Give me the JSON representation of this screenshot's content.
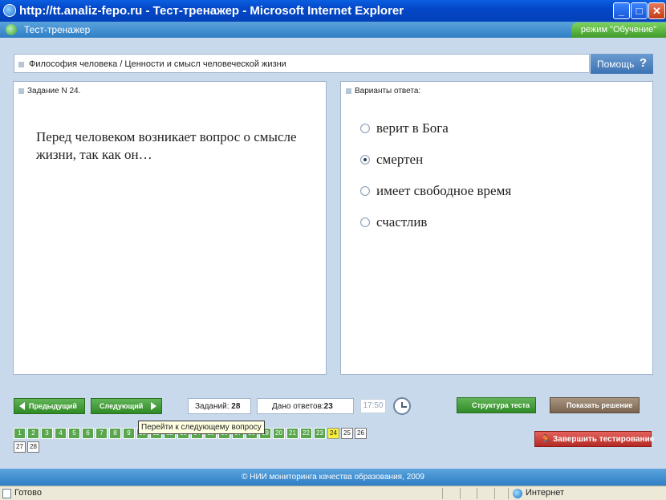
{
  "window": {
    "title": "http://tt.analiz-fepo.ru - Тест-тренажер - Microsoft Internet Explorer",
    "minimize": "_",
    "maximize": "□",
    "close": "✕"
  },
  "app": {
    "title": "Тест-тренажер",
    "mode": "режим \"Обучение\""
  },
  "breadcrumb": "Философия человека / Ценности и смысл человеческой жизни",
  "help": {
    "label": "Помощь",
    "icon": "?"
  },
  "task": {
    "header": "Задание N 24.",
    "question": "Перед человеком возникает вопрос о смысле жизни, так как он…"
  },
  "answers": {
    "header": "Варианты ответа:",
    "options": [
      "верит в Бога",
      "смертен",
      "имеет свободное время",
      "счастлив"
    ],
    "selected_index": 1
  },
  "nav": {
    "prev": "Предыдущий",
    "next": "Следующий",
    "tasks_label": "Заданий:",
    "tasks_value": "28",
    "answers_label": "Дано ответов:",
    "answers_value": "23",
    "time": "17:50",
    "structure": "Структура теста",
    "show_solution": "Показать решение",
    "finish": "Завершить тестирование",
    "tooltip": "Перейти к следующему вопросу"
  },
  "question_grid": {
    "labels": [
      "1",
      "2",
      "3",
      "4",
      "5",
      "6",
      "7",
      "8",
      "9",
      "10",
      "11",
      "12",
      "13",
      "14",
      "15",
      "16",
      "17",
      "18",
      "19",
      "20",
      "21",
      "22",
      "23",
      "24",
      "25",
      "26",
      "27",
      "28"
    ],
    "answered_count": 23,
    "current": 24
  },
  "footer": "© НИИ мониторинга качества образования, 2009",
  "statusbar": {
    "status": "Готово",
    "zone": "Интернет"
  },
  "colors": {
    "answered": "#5aa64f",
    "current": "#f6ef3a",
    "unanswered": "#ffffff",
    "header_blue": "#2f7ec4"
  }
}
